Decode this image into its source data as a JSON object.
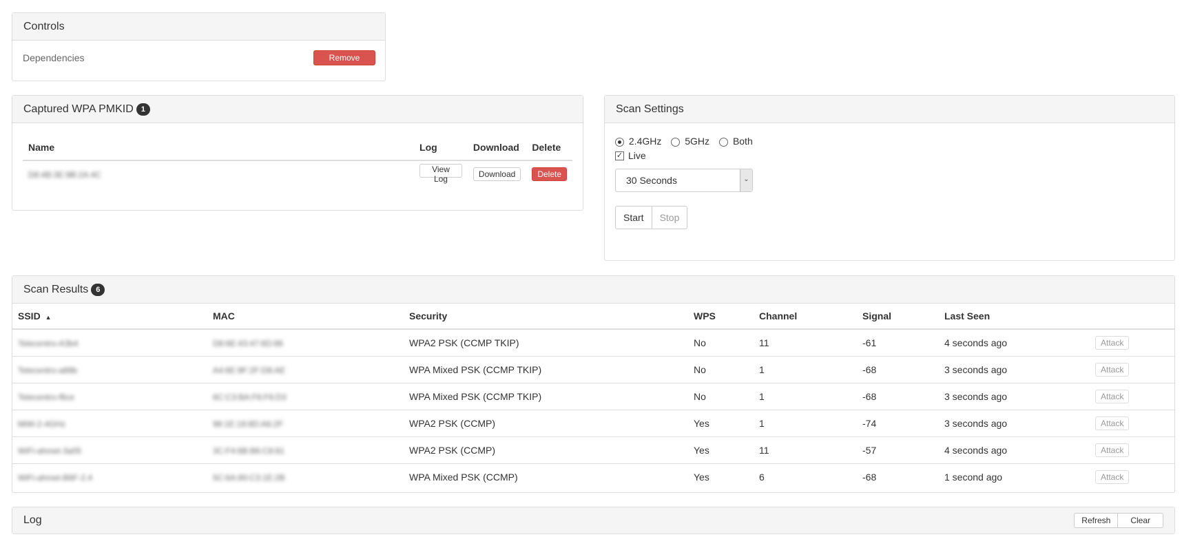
{
  "controls": {
    "title": "Controls",
    "dependencies_label": "Dependencies",
    "remove_label": "Remove"
  },
  "captured": {
    "title": "Captured WPA PMKID",
    "count": "1",
    "headers": {
      "name": "Name",
      "log": "Log",
      "download": "Download",
      "delete": "Delete"
    },
    "rows": [
      {
        "name": "D8:4B:3E:9B:2A:4C",
        "log_label": "View Log",
        "download_label": "Download",
        "delete_label": "Delete"
      }
    ]
  },
  "scan_settings": {
    "title": "Scan Settings",
    "band_options": [
      {
        "label": "2.4GHz",
        "checked": true
      },
      {
        "label": "5GHz",
        "checked": false
      },
      {
        "label": "Both",
        "checked": false
      }
    ],
    "live_label": "Live",
    "live_checked": true,
    "duration_value": "30 Seconds",
    "start_label": "Start",
    "stop_label": "Stop"
  },
  "results": {
    "title": "Scan Results",
    "count": "6",
    "headers": {
      "ssid": "SSID",
      "mac": "MAC",
      "security": "Security",
      "wps": "WPS",
      "channel": "Channel",
      "signal": "Signal",
      "last_seen": "Last Seen"
    },
    "attack_label": "Attack",
    "rows": [
      {
        "ssid": "Telecentro-A3b4",
        "mac": "D8:6E:43:47:6D:86",
        "security": "WPA2 PSK (CCMP TKIP)",
        "wps": "No",
        "channel": "11",
        "signal": "-61",
        "last_seen": "4 seconds ago"
      },
      {
        "ssid": "Telecentro-a88b",
        "mac": "A4:6E:9F:2F:D8:AE",
        "security": "WPA Mixed PSK (CCMP TKIP)",
        "wps": "No",
        "channel": "1",
        "signal": "-68",
        "last_seen": "3 seconds ago"
      },
      {
        "ssid": "Telecentro-f6ce",
        "mac": "6C:C3:BA:F6:F6:D3",
        "security": "WPA Mixed PSK (CCMP TKIP)",
        "wps": "No",
        "channel": "1",
        "signal": "-68",
        "last_seen": "3 seconds ago"
      },
      {
        "ssid": "MiW-2-4GHz",
        "mac": "98:1E:19:8D:A6:2F",
        "security": "WPA2 PSK (CCMP)",
        "wps": "Yes",
        "channel": "1",
        "signal": "-74",
        "last_seen": "3 seconds ago"
      },
      {
        "ssid": "WiFi-ahmet-3a05",
        "mac": "3C:F4:6B:B6:C8:81",
        "security": "WPA2 PSK (CCMP)",
        "wps": "Yes",
        "channel": "11",
        "signal": "-57",
        "last_seen": "4 seconds ago"
      },
      {
        "ssid": "WiFi-ahmet-B6F-2.4",
        "mac": "5C:6A:80:C3:1E:2B",
        "security": "WPA Mixed PSK (CCMP)",
        "wps": "Yes",
        "channel": "6",
        "signal": "-68",
        "last_seen": "1 second ago"
      }
    ]
  },
  "log": {
    "title": "Log",
    "refresh_label": "Refresh",
    "clear_label": "Clear"
  }
}
